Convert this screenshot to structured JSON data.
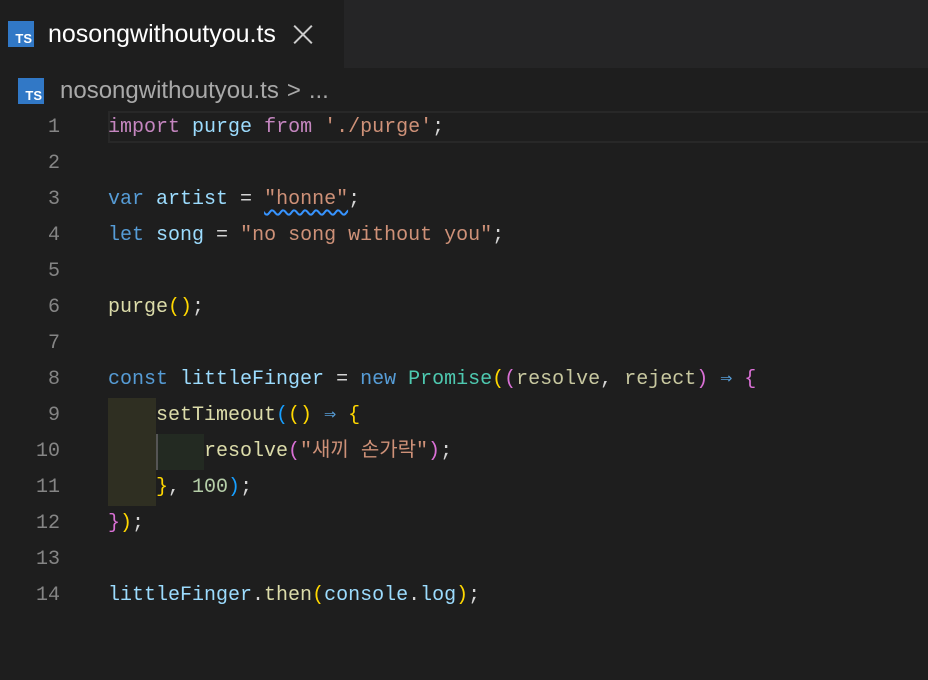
{
  "tab": {
    "label": "nosongwithoutyou.ts",
    "icon": "typescript-file-icon",
    "icon_text": "TS"
  },
  "breadcrumb": {
    "file": "nosongwithoutyou.ts",
    "separator": ">",
    "ellipsis": "..."
  },
  "editor": {
    "line_numbers": [
      "1",
      "2",
      "3",
      "4",
      "5",
      "6",
      "7",
      "8",
      "9",
      "10",
      "11",
      "12",
      "13",
      "14"
    ],
    "code": {
      "l1": {
        "import": "import",
        "purge": "purge",
        "from": "from",
        "path": "'./purge'",
        "semi": ";"
      },
      "l3": {
        "var": "var",
        "artist": "artist",
        "eq": " = ",
        "value": "\"honne\"",
        "semi": ";"
      },
      "l4": {
        "let": "let",
        "song": "song",
        "eq": " = ",
        "value": "\"no song without you\"",
        "semi": ";"
      },
      "l6": {
        "fn": "purge",
        "open": "(",
        "close": ")",
        "semi": ";"
      },
      "l8": {
        "const": "const",
        "name": "littleFinger",
        "eq": " = ",
        "new": "new",
        "cls": "Promise",
        "p_open": "(",
        "inner_open": "(",
        "resolve": "resolve",
        "comma": ", ",
        "reject": "reject",
        "inner_close": ")",
        "arrow": "⇒",
        "brace": "{"
      },
      "l9": {
        "fn": "setTimeout",
        "open": "(",
        "args": "()",
        "arrow": "⇒",
        "brace": "{"
      },
      "l10": {
        "fn": "resolve",
        "open": "(",
        "value": "\"새끼 손가락\"",
        "close": ")",
        "semi": ";"
      },
      "l11": {
        "brace": "}",
        "comma": ", ",
        "num": "100",
        "close": ")",
        "semi": ";"
      },
      "l12": {
        "brace": "}",
        "close": ")",
        "semi": ";"
      },
      "l14": {
        "obj": "littleFinger",
        "dot1": ".",
        "then": "then",
        "open": "(",
        "console": "console",
        "dot2": ".",
        "log": "log",
        "close": ")",
        "semi": ";"
      }
    }
  },
  "colors": {
    "background": "#1e1e1e",
    "ts_icon": "#3178c6",
    "keyword": "#c586c0",
    "string": "#ce9178"
  }
}
